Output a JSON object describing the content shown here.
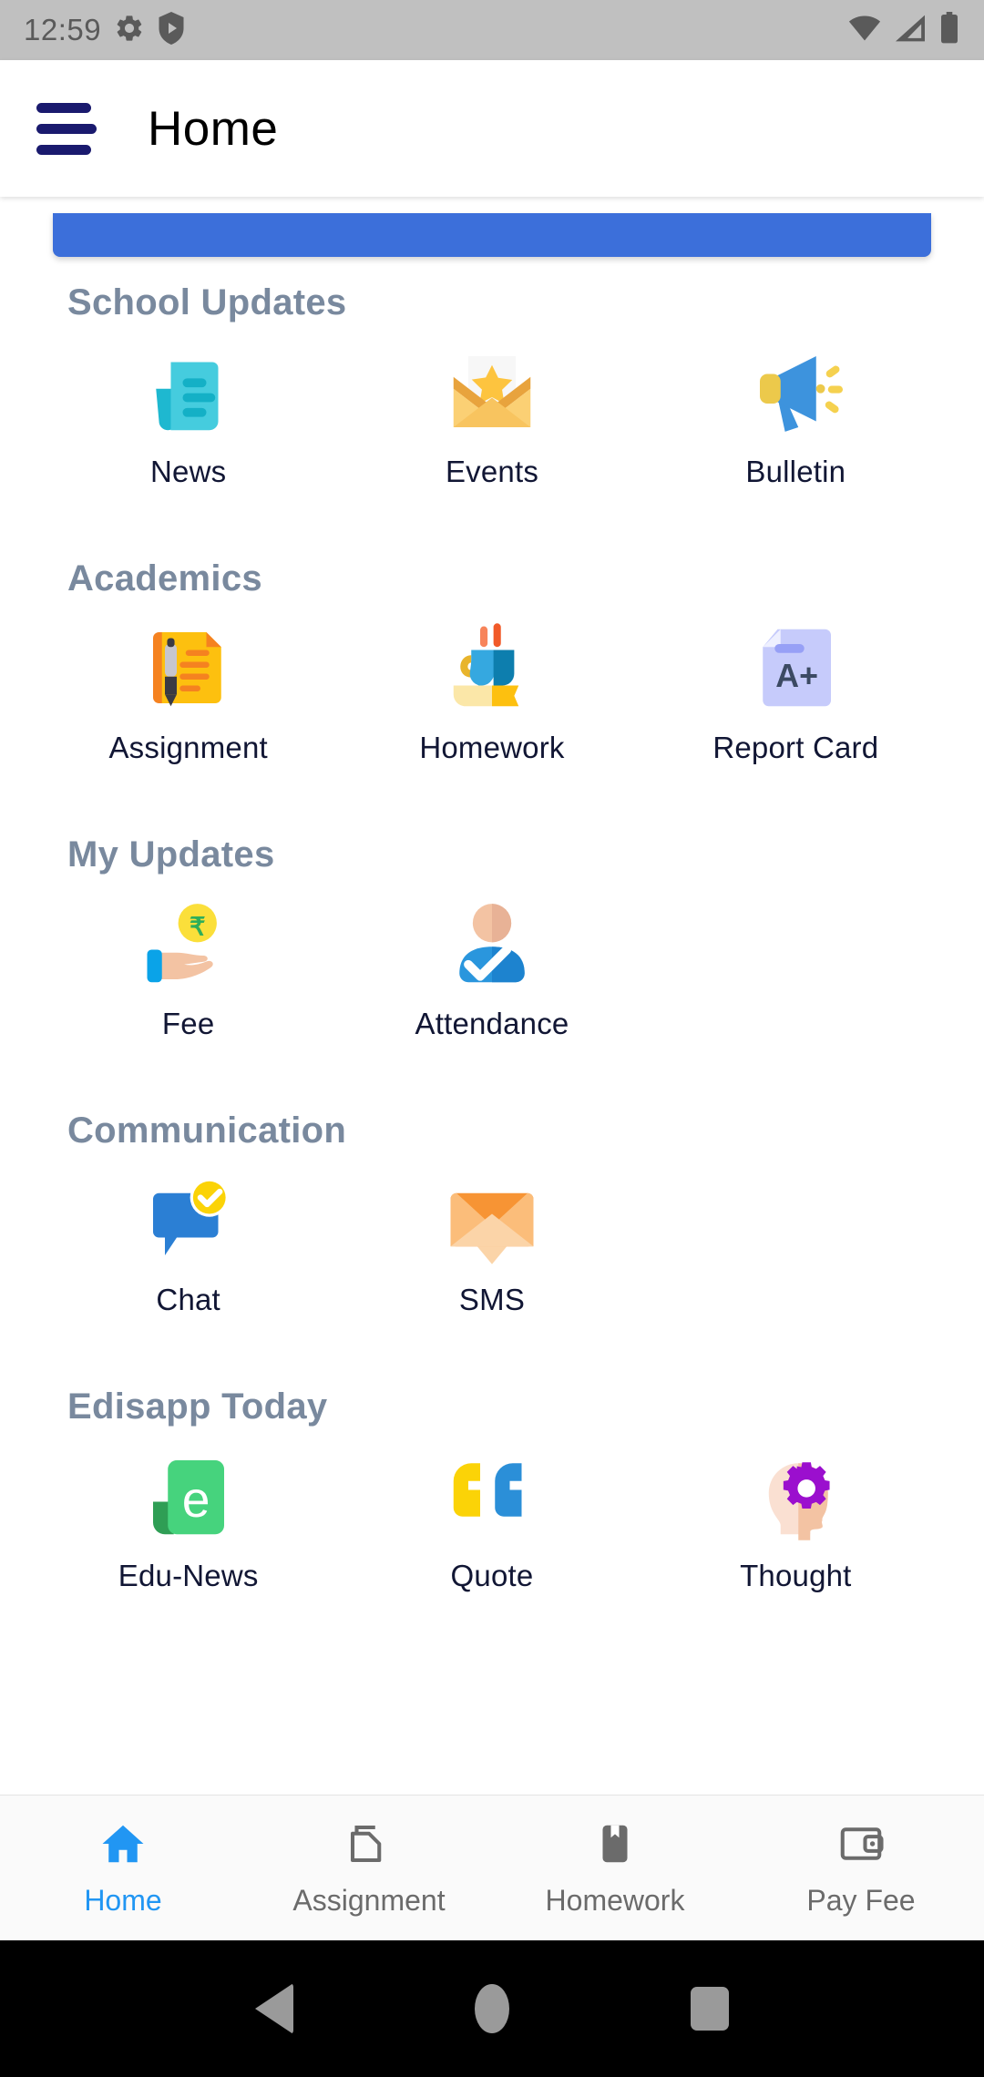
{
  "statusbar": {
    "time": "12:59",
    "left_icons": [
      "gear-icon",
      "shield-play-icon"
    ],
    "right_icons": [
      "wifi-icon",
      "cell-signal-icon",
      "battery-icon"
    ],
    "background": "#c0c0c0"
  },
  "appbar": {
    "title": "Home",
    "menu_icon": "hamburger-menu-icon",
    "menu_color": "#1a1a6e",
    "title_color": "#000000"
  },
  "banner": {
    "color": "#3c6fda"
  },
  "theme": {
    "section_title_color": "#79899e",
    "tile_label_color": "#111634",
    "active_nav_color": "#2196f3",
    "inactive_nav_color": "#6b6b6b"
  },
  "sections": [
    {
      "title": "School Updates",
      "items": [
        {
          "label": "News",
          "icon": "news-document-icon"
        },
        {
          "label": "Events",
          "icon": "envelope-star-icon"
        },
        {
          "label": "Bulletin",
          "icon": "megaphone-icon"
        }
      ]
    },
    {
      "title": "Academics",
      "items": [
        {
          "label": "Assignment",
          "icon": "notepad-pen-icon"
        },
        {
          "label": "Homework",
          "icon": "cup-book-icon"
        },
        {
          "label": "Report Card",
          "icon": "report-card-a-plus-icon"
        }
      ]
    },
    {
      "title": "My Updates",
      "items": [
        {
          "label": "Fee",
          "icon": "hand-rupee-coin-icon"
        },
        {
          "label": "Attendance",
          "icon": "person-check-icon"
        }
      ]
    },
    {
      "title": "Communication",
      "items": [
        {
          "label": "Chat",
          "icon": "chat-bubble-check-icon"
        },
        {
          "label": "SMS",
          "icon": "orange-envelope-icon"
        }
      ]
    },
    {
      "title": "Edisapp Today",
      "items": [
        {
          "label": "Edu-News",
          "icon": "green-e-icon"
        },
        {
          "label": "Quote",
          "icon": "quotation-marks-icon"
        },
        {
          "label": "Thought",
          "icon": "head-gear-icon"
        }
      ]
    }
  ],
  "bottom_nav": {
    "items": [
      {
        "label": "Home",
        "icon": "home-icon",
        "active": true
      },
      {
        "label": "Assignment",
        "icon": "copy-documents-icon",
        "active": false
      },
      {
        "label": "Homework",
        "icon": "book-bookmark-icon",
        "active": false
      },
      {
        "label": "Pay Fee",
        "icon": "wallet-icon",
        "active": false
      }
    ]
  },
  "android_nav": {
    "back": "back-triangle-icon",
    "home": "home-circle-icon",
    "recents": "recents-square-icon"
  }
}
